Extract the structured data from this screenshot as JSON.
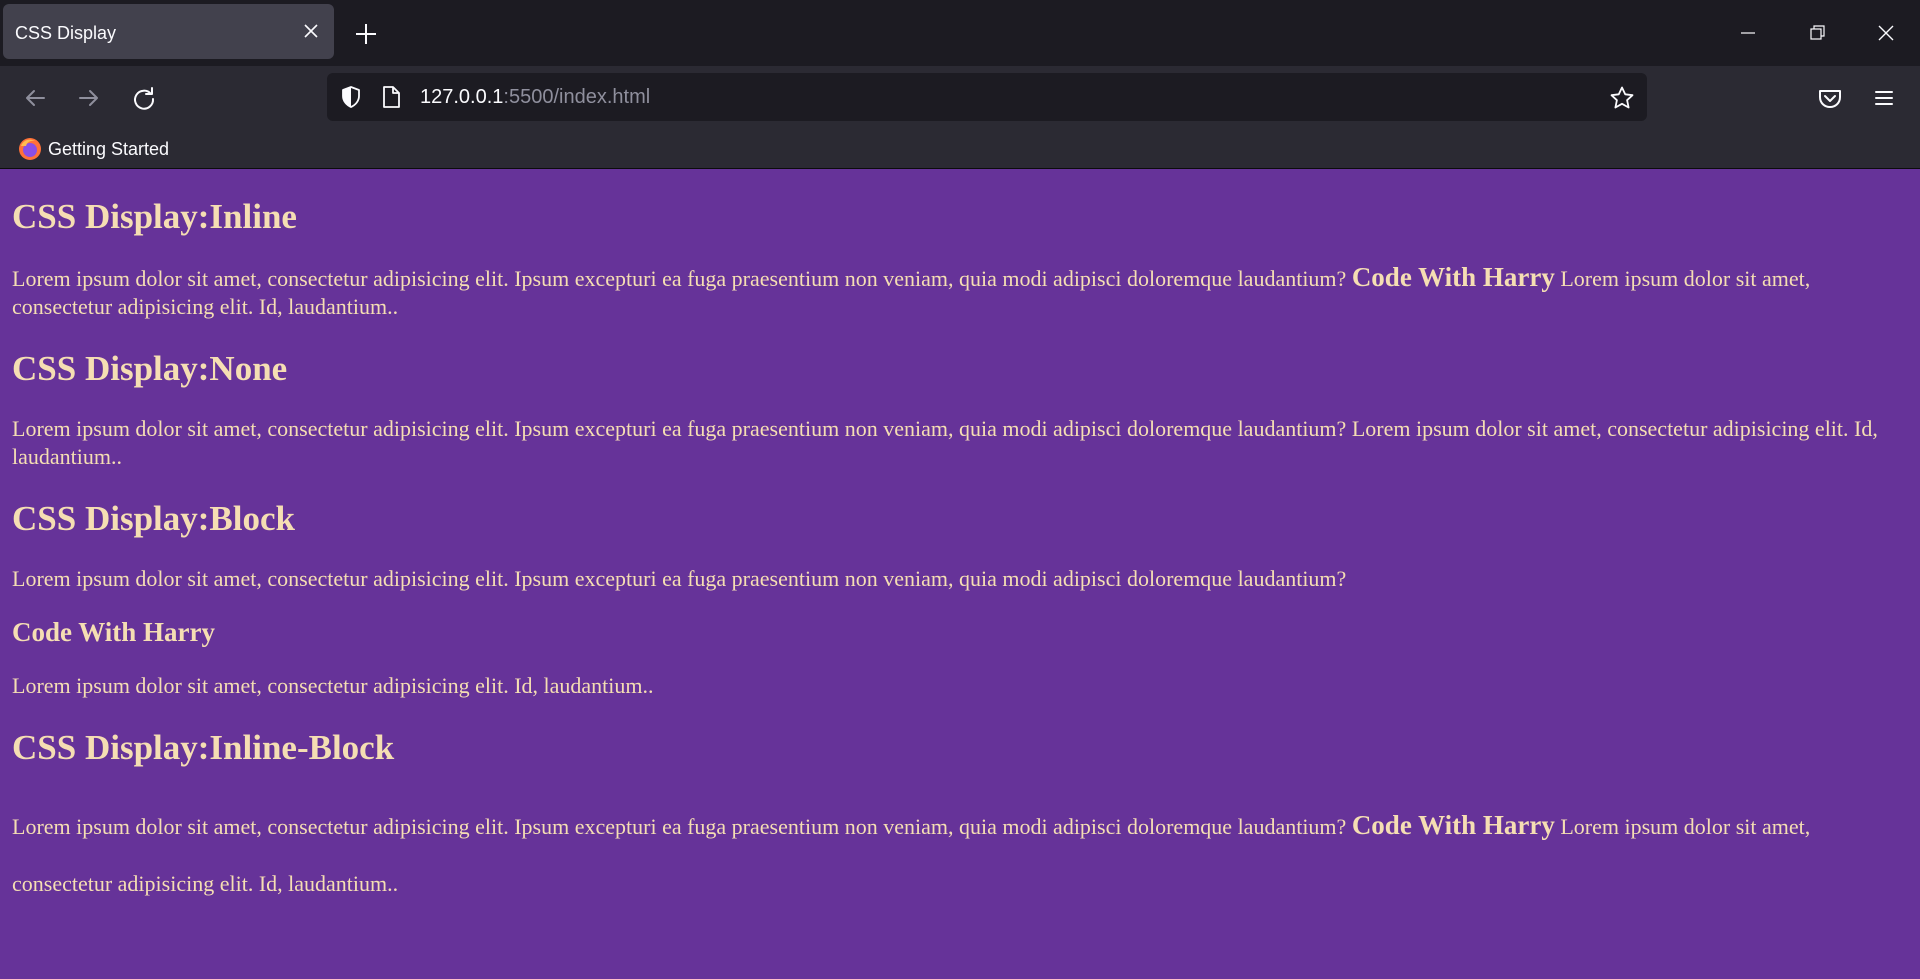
{
  "browser": {
    "tab_title": "CSS Display",
    "url_host": "127.0.0.1",
    "url_rest": ":5500/index.html",
    "bookmark": "Getting Started"
  },
  "sections": [
    {
      "heading": "CSS Display:Inline",
      "text_before": "Lorem ipsum dolor sit amet, consectetur adipisicing elit. Ipsum excepturi ea fuga praesentium non veniam, quia modi adipisci doloremque laudantium?",
      "name": "Code With Harry",
      "text_after": "Lorem ipsum dolor sit amet, consectetur adipisicing elit. Id, laudantium.."
    },
    {
      "heading": "CSS Display:None",
      "text_before": "Lorem ipsum dolor sit amet, consectetur adipisicing elit. Ipsum excepturi ea fuga praesentium non veniam, quia modi adipisci doloremque laudantium?",
      "text_after": "Lorem ipsum dolor sit amet, consectetur adipisicing elit. Id, laudantium.."
    },
    {
      "heading": "CSS Display:Block",
      "text_before": "Lorem ipsum dolor sit amet, consectetur adipisicing elit. Ipsum excepturi ea fuga praesentium non veniam, quia modi adipisci doloremque laudantium?",
      "name": "Code With Harry",
      "text_after": "Lorem ipsum dolor sit amet, consectetur adipisicing elit. Id, laudantium.."
    },
    {
      "heading": "CSS Display:Inline-Block",
      "text_before": "Lorem ipsum dolor sit amet, consectetur adipisicing elit. Ipsum excepturi ea fuga praesentium non veniam, quia modi adipisci doloremque laudantium?",
      "name": "Code With Harry",
      "text_after": "Lorem ipsum dolor sit amet, consectetur adipisicing elit. Id, laudantium.."
    }
  ],
  "colors": {
    "page_background": "#663399",
    "page_text": "#f5deb3",
    "chrome_dark": "#1c1b22",
    "chrome_mid": "#2b2a33"
  }
}
